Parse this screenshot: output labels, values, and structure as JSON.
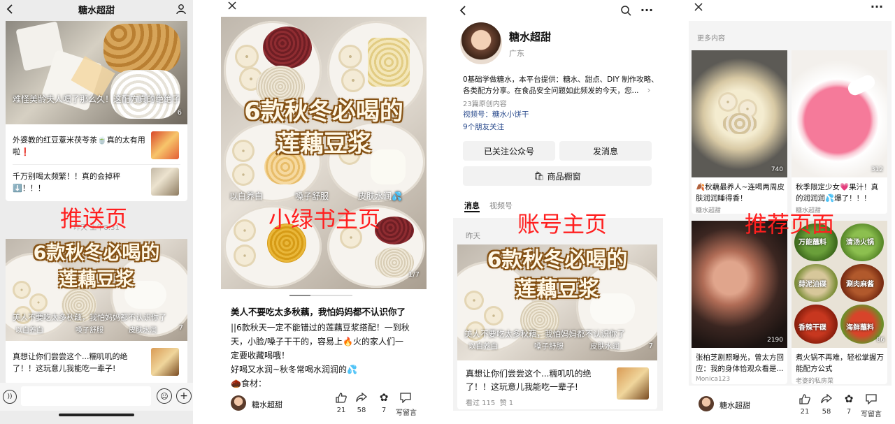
{
  "overlays": {
    "p1": "推送页",
    "p2": "小绿书主页",
    "p3": "账号主页",
    "p4": "推荐页面"
  },
  "p1": {
    "title": "糖水超甜",
    "hero_caption": "难怪美龄夫人喝了那么久！这配方真的绝绝子",
    "hero_count": "6",
    "items": [
      {
        "text": "外婆教的红豆薏米茯苓茶🍵真的太有用啦❗"
      },
      {
        "text": "千万别喝太频繁！！真的会掉秤⬇️！！！"
      }
    ],
    "date_label": "昨天 上午8:31",
    "card2_title_line1": "6款秋冬必喝的",
    "card2_title_line2": "莲藕豆浆",
    "card2_caption": "美人不要吃太多秋藕，我怕妈妈都不认识你了",
    "card2_tags": [
      "以白养白",
      "嗓子舒服",
      "皮肤水润"
    ],
    "card2_count": "7",
    "item3": "真想让你们尝尝这个...糯叽叽的绝了！！这玩意儿我能吃一辈子!"
  },
  "p2": {
    "title_line1": "6款秋冬必喝的",
    "title_line2": "莲藕豆浆",
    "tags": [
      "以白养白",
      "嗓子舒服",
      "皮肤水润💦"
    ],
    "page": "1/7",
    "headline": "美人不要吃太多秋藕，我怕妈妈都不认识你了",
    "body_lines": [
      "||6款秋天一定不能错过的莲藕豆浆搭配！一到秋",
      "天，小脸/嗓子干干的，容易上🔥火的家人们一",
      "定要收藏喝哦！",
      "好喝又水润~秋冬常喝水润润的💦",
      "🌰食材："
    ],
    "author": "糖水超甜",
    "stats": [
      {
        "v": "21"
      },
      {
        "v": "58"
      },
      {
        "v": "7"
      },
      {
        "v": "写留言"
      }
    ]
  },
  "p3": {
    "name": "糖水超甜",
    "location": "广东",
    "desc_line1": "0基础学做糖水，本平台提供：糖水、甜点、DIY 制作攻略、",
    "desc_line2": "各类配方分享。在食品安全问题如此频发的今天，您...",
    "originals": "23篇原创内容",
    "video_label": "视频号：",
    "video_name": "糖水小饼干",
    "friends": "9个朋友关注",
    "btn_followed": "已关注公众号",
    "btn_message": "发消息",
    "btn_shop": "商品橱窗",
    "tabs": [
      "消息",
      "视频号"
    ],
    "date_label": "昨天",
    "card_title_line1": "6款秋冬必喝的",
    "card_title_line2": "莲藕豆浆",
    "card_caption": "美人不要吃太多秋藕，我怕妈妈都不认识你了",
    "card_tags": [
      "以白养白",
      "嗓子舒服",
      "皮肤水润"
    ],
    "card_count": "7",
    "item_text": "真想让你们尝尝这个...糯叽叽的绝了！！这玩意儿我能吃一辈子!",
    "item_meta": "看过 115  赞 1"
  },
  "p4": {
    "section": "更多内容",
    "cards": [
      {
        "title": "🍂秋藕最养人~连喝两周皮肤润润睡得香！",
        "author": "糖水超甜",
        "count": "740"
      },
      {
        "title": "秋季限定少女💗果汁！真的润润润💦爆了！！！",
        "author": "糖水超甜",
        "count": "312"
      },
      {
        "title": "张柏芝剧照曝光，曾太方回应：我的身体恰观众看是...",
        "author": "Monica123",
        "count": "2190"
      },
      {
        "title": "煮火锅不再难，轻松掌握万能配方公式",
        "author": "老婆的私房菜",
        "count": "86"
      }
    ],
    "sauce_labels": [
      "万能蘸料",
      "清汤火锅",
      "蒜泥油碟",
      "涮肉麻酱",
      "香辣干碟",
      "海鲜蘸料"
    ],
    "author": "糖水超甜",
    "stats": [
      {
        "v": "21"
      },
      {
        "v": "58"
      },
      {
        "v": "7"
      },
      {
        "v": "写留言"
      }
    ]
  }
}
